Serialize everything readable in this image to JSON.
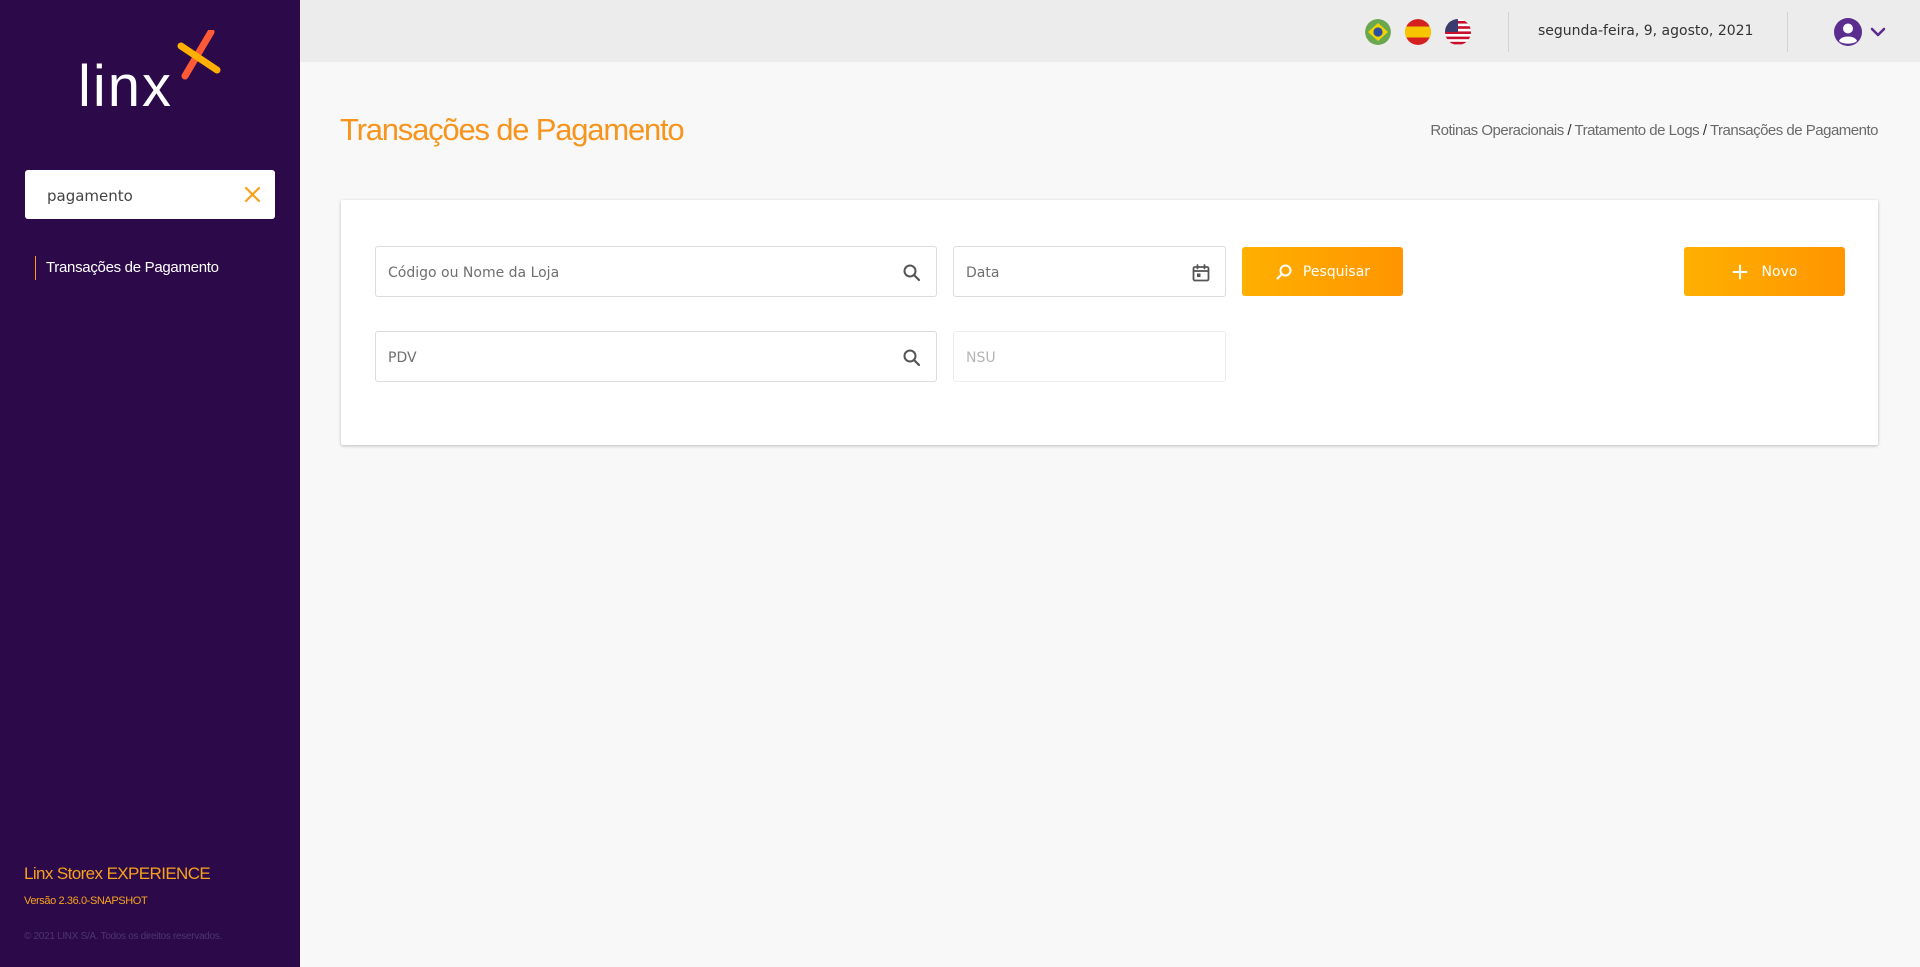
{
  "app": {
    "logo_text": "linx",
    "product_name": "Linx Storex EXPERIENCE",
    "version": "Versão 2.36.0-SNAPSHOT",
    "copyright": "© 2021 LINX S/A. Todos os direitos reservados."
  },
  "sidebar": {
    "search_value": "pagamento",
    "items": [
      {
        "label": "Transações de Pagamento",
        "active": true
      }
    ]
  },
  "topbar": {
    "languages": [
      "Português (Brasil)",
      "Español",
      "English (US)"
    ],
    "date": "segunda-feira, 9, agosto, 2021"
  },
  "page": {
    "title": "Transações de Pagamento",
    "breadcrumb": [
      "Rotinas Operacionais",
      "Tratamento de Logs",
      "Transações de Pagamento"
    ]
  },
  "filters": {
    "store_placeholder": "Código ou Nome da Loja",
    "date_placeholder": "Data",
    "pdv_placeholder": "PDV",
    "nsu_placeholder": "NSU",
    "search_label": "Pesquisar",
    "new_label": "Novo"
  },
  "colors": {
    "sidebar_bg": "#2c0a4a",
    "accent": "#f7941d",
    "button_start": "#ffb000",
    "button_end": "#ff9500"
  }
}
